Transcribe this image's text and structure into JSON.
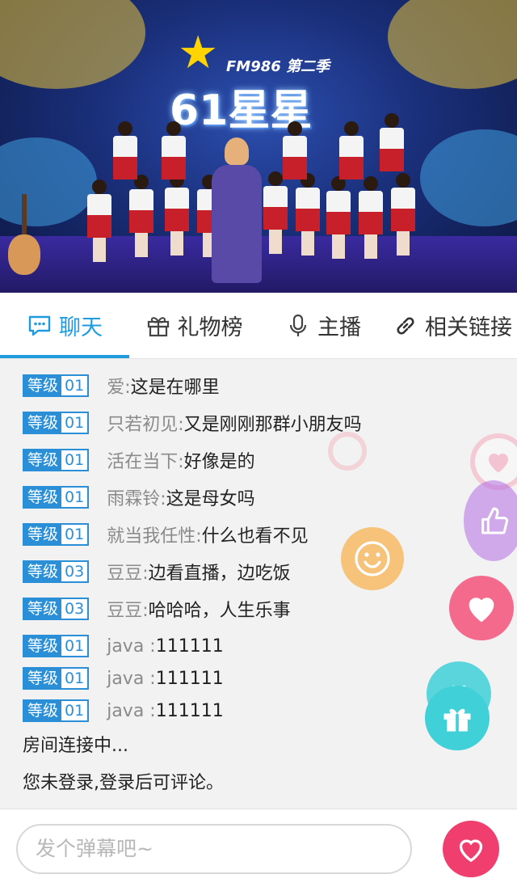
{
  "video": {
    "logo_fm": "FM986",
    "logo_season": "第二季",
    "logo_main": "61星星"
  },
  "tabs": [
    {
      "label": "聊天",
      "icon": "chat-bubble-icon",
      "active": true
    },
    {
      "label": "礼物榜",
      "icon": "gift-icon",
      "active": false
    },
    {
      "label": "主播",
      "icon": "microphone-icon",
      "active": false
    },
    {
      "label": "相关链接",
      "icon": "link-icon",
      "active": false
    }
  ],
  "chat": {
    "messages": [
      {
        "badge_label": "等级",
        "badge_level": "01",
        "user": "爱:",
        "text": "这是在哪里"
      },
      {
        "badge_label": "等级",
        "badge_level": "01",
        "user": "只若初见:",
        "text": "又是刚刚那群小朋友吗"
      },
      {
        "badge_label": "等级",
        "badge_level": "01",
        "user": "活在当下:",
        "text": "好像是的"
      },
      {
        "badge_label": "等级",
        "badge_level": "01",
        "user": "雨霖铃:",
        "text": "这是母女吗"
      },
      {
        "badge_label": "等级",
        "badge_level": "01",
        "user": "就当我任性:",
        "text": "什么也看不见"
      },
      {
        "badge_label": "等级",
        "badge_level": "03",
        "user": "豆豆:",
        "text": "边看直播，边吃饭"
      },
      {
        "badge_label": "等级",
        "badge_level": "03",
        "user": "豆豆:",
        "text": "哈哈哈，人生乐事"
      },
      {
        "badge_label": "等级",
        "badge_level": "01",
        "user": "java :",
        "text": "111111"
      },
      {
        "badge_label": "等级",
        "badge_level": "01",
        "user": "java :",
        "text": "111111"
      },
      {
        "badge_label": "等级",
        "badge_level": "01",
        "user": "java :",
        "text": "111111"
      }
    ],
    "system_connecting": "房间连接中...",
    "system_login": "您未登录,登录后可评论。"
  },
  "input": {
    "placeholder": "发个弹幕吧~"
  },
  "colors": {
    "accent": "#1f9be0",
    "badge": "#2b8fd8",
    "like": "#f03e6e",
    "gift": "#3fd0d8"
  }
}
